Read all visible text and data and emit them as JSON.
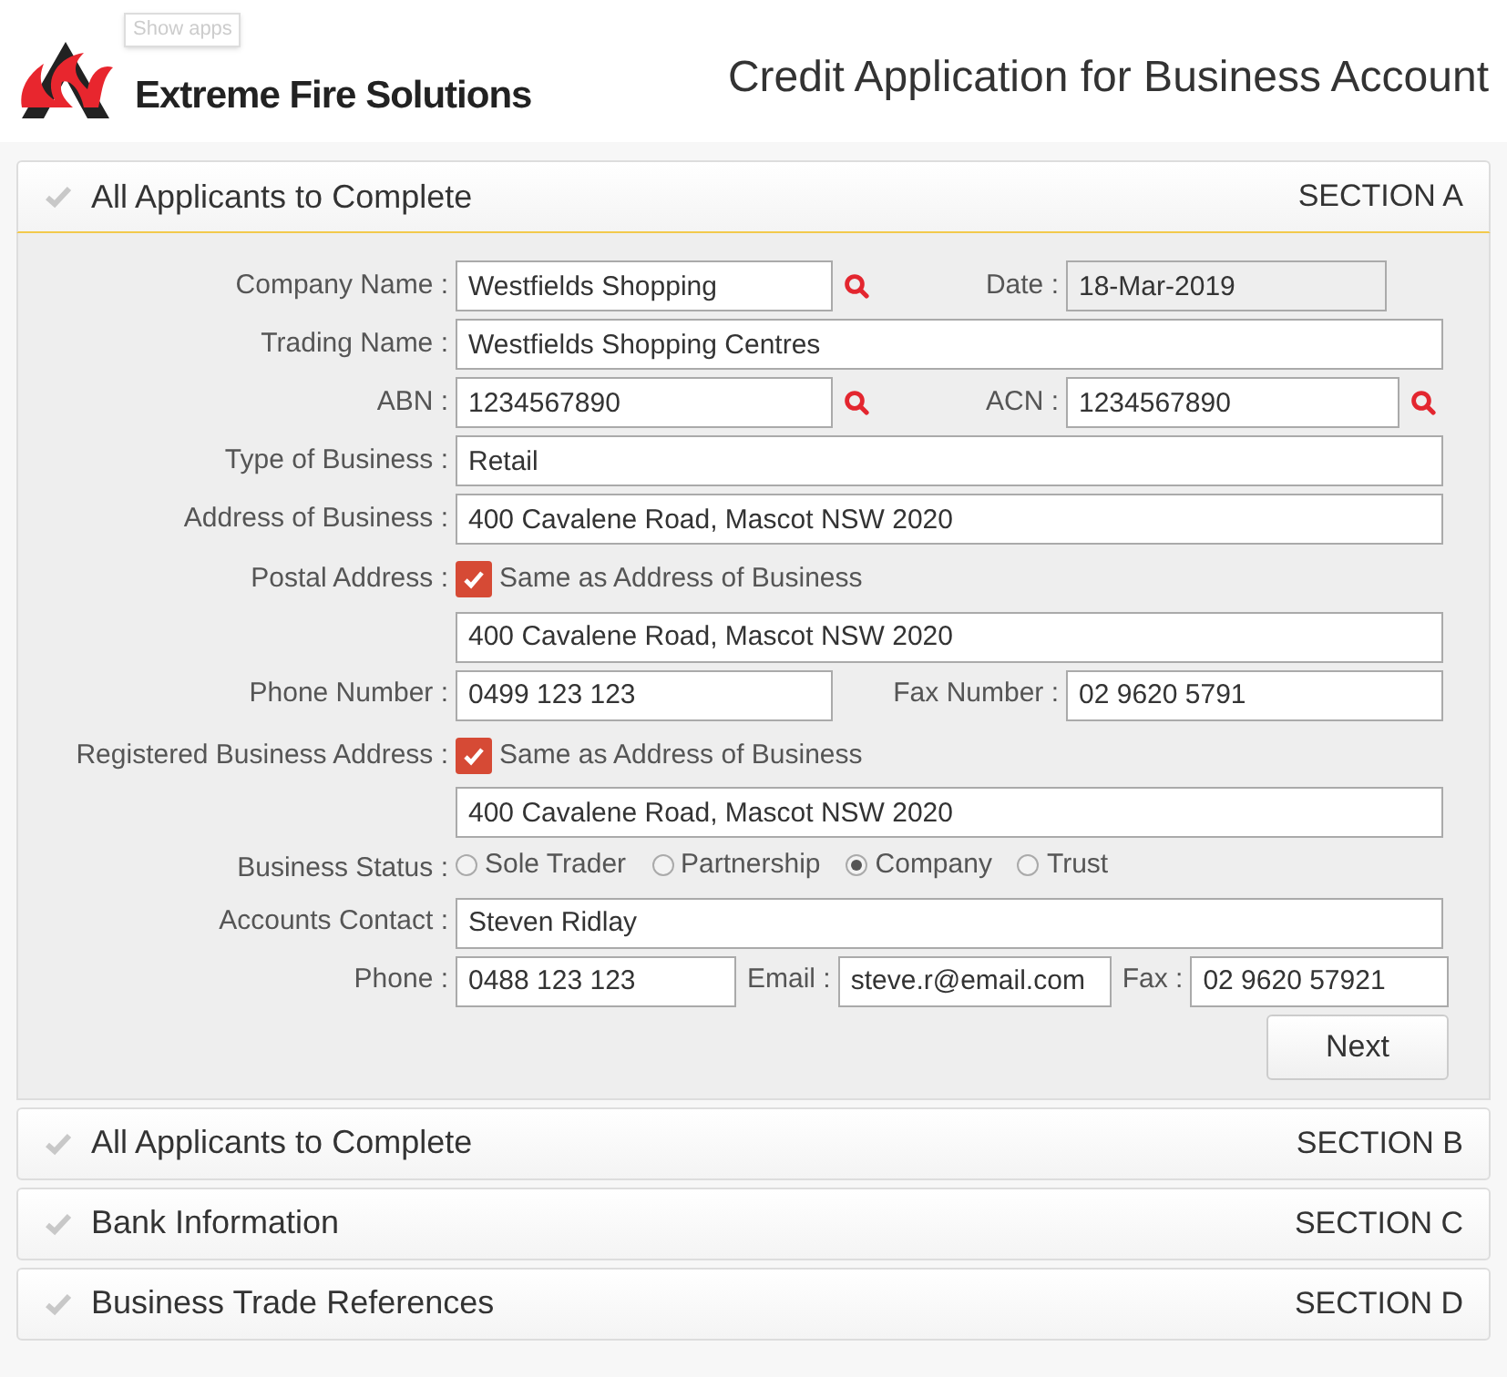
{
  "header": {
    "show_apps": "Show apps",
    "brand": "Extreme Fire Solutions",
    "title": "Credit Application for Business Account"
  },
  "sections": [
    {
      "title": "All Applicants to Complete",
      "label": "SECTION A",
      "expanded": true
    },
    {
      "title": "All Applicants to Complete",
      "label": "SECTION B",
      "expanded": false
    },
    {
      "title": "Bank Information",
      "label": "SECTION C",
      "expanded": false
    },
    {
      "title": "Business Trade References",
      "label": "SECTION D",
      "expanded": false
    }
  ],
  "form": {
    "rows": [
      {
        "kind": "pair",
        "label": "Company Name :",
        "value": "Westfields Shopping",
        "search": true,
        "label2": "Date :",
        "value2": "18-Mar-2019",
        "disabled2": true,
        "search2": false
      },
      {
        "kind": "text",
        "label": "Trading Name :",
        "value": "Westfields Shopping Centres"
      },
      {
        "kind": "pair",
        "label": "ABN :",
        "value": "1234567890",
        "search": true,
        "label2": "ACN :",
        "value2": "1234567890",
        "disabled2": false,
        "search2": true
      },
      {
        "kind": "text",
        "label": "Type of Business :",
        "value": "Retail"
      },
      {
        "kind": "text",
        "label": "Address of Business :",
        "value": "400 Cavalene Road, Mascot NSW 2020"
      },
      {
        "kind": "checkbox",
        "label": "Postal Address :",
        "checkbox_label": "Same as Address of Business",
        "checked": true,
        "value": "400 Cavalene Road, Mascot NSW 2020"
      },
      {
        "kind": "pair",
        "label": "Phone Number :",
        "value": "0499 123 123",
        "search": false,
        "label2": "Fax Number :",
        "value2": "02 9620 5791",
        "disabled2": false,
        "search2": false
      },
      {
        "kind": "checkbox",
        "label": "Registered Business Address :",
        "checkbox_label": "Same as Address of Business",
        "checked": true,
        "value": "400 Cavalene Road, Mascot NSW 2020"
      },
      {
        "kind": "radios",
        "label": "Business Status :",
        "options": [
          {
            "label": "Sole Trader",
            "selected": false
          },
          {
            "label": "Partnership",
            "selected": false
          },
          {
            "label": "Company",
            "selected": true
          },
          {
            "label": "Trust",
            "selected": false
          }
        ]
      },
      {
        "kind": "text",
        "label": "Accounts Contact :",
        "value": "Steven Ridlay"
      },
      {
        "kind": "triple",
        "fields": [
          {
            "label": "Phone :",
            "value": "0488 123 123"
          },
          {
            "label": "Email :",
            "value": "steve.r@email.com"
          },
          {
            "label": "Fax :",
            "value": "02 9620 57921"
          }
        ]
      }
    ],
    "next": "Next"
  }
}
